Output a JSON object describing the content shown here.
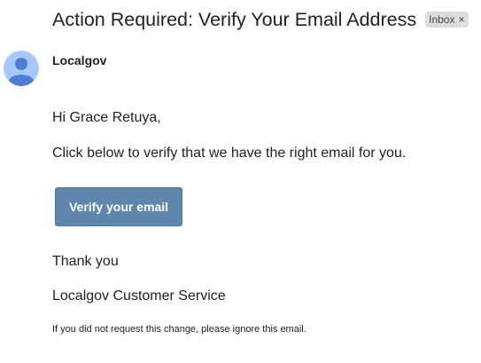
{
  "email": {
    "subject": "Action Required: Verify Your Email Address",
    "label": "Inbox",
    "label_remove": "×",
    "sender": "Localgov",
    "greeting": "Hi Grace Retuya,",
    "instruction": "Click below to verify that we have the right email for you.",
    "button_label": "Verify your email",
    "thanks": "Thank you",
    "signoff": "Localgov Customer Service",
    "footnote": "If you did not request this change, please ignore this email."
  },
  "colors": {
    "avatar_bg": "#a8c7fa",
    "avatar_fg": "#4a7fd6",
    "button_bg": "#5f87ad",
    "label_bg": "#dddddd"
  },
  "icons": {
    "avatar": "person-avatar-icon",
    "remove_label": "close-icon"
  }
}
